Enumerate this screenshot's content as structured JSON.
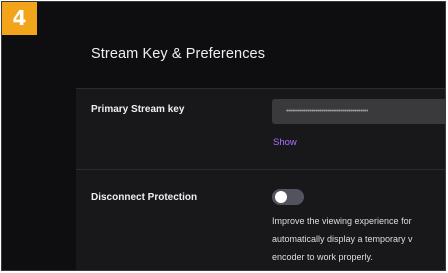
{
  "step": {
    "number": "4",
    "color": "#f2a51a"
  },
  "section": {
    "title": "Stream Key & Preferences"
  },
  "primary_stream_key": {
    "label": "Primary Stream key",
    "masked_value": "••••••••••••••••••••••••••••••••••••••••••",
    "show_label": "Show"
  },
  "disconnect_protection": {
    "label": "Disconnect Protection",
    "toggle_state": "off",
    "description_lines": [
      "Improve the viewing experience for",
      "automatically display a temporary v",
      "encoder to work properly."
    ]
  },
  "colors": {
    "background": "#0e0e10",
    "card": "#18181b",
    "accent_link": "#a970ff"
  }
}
